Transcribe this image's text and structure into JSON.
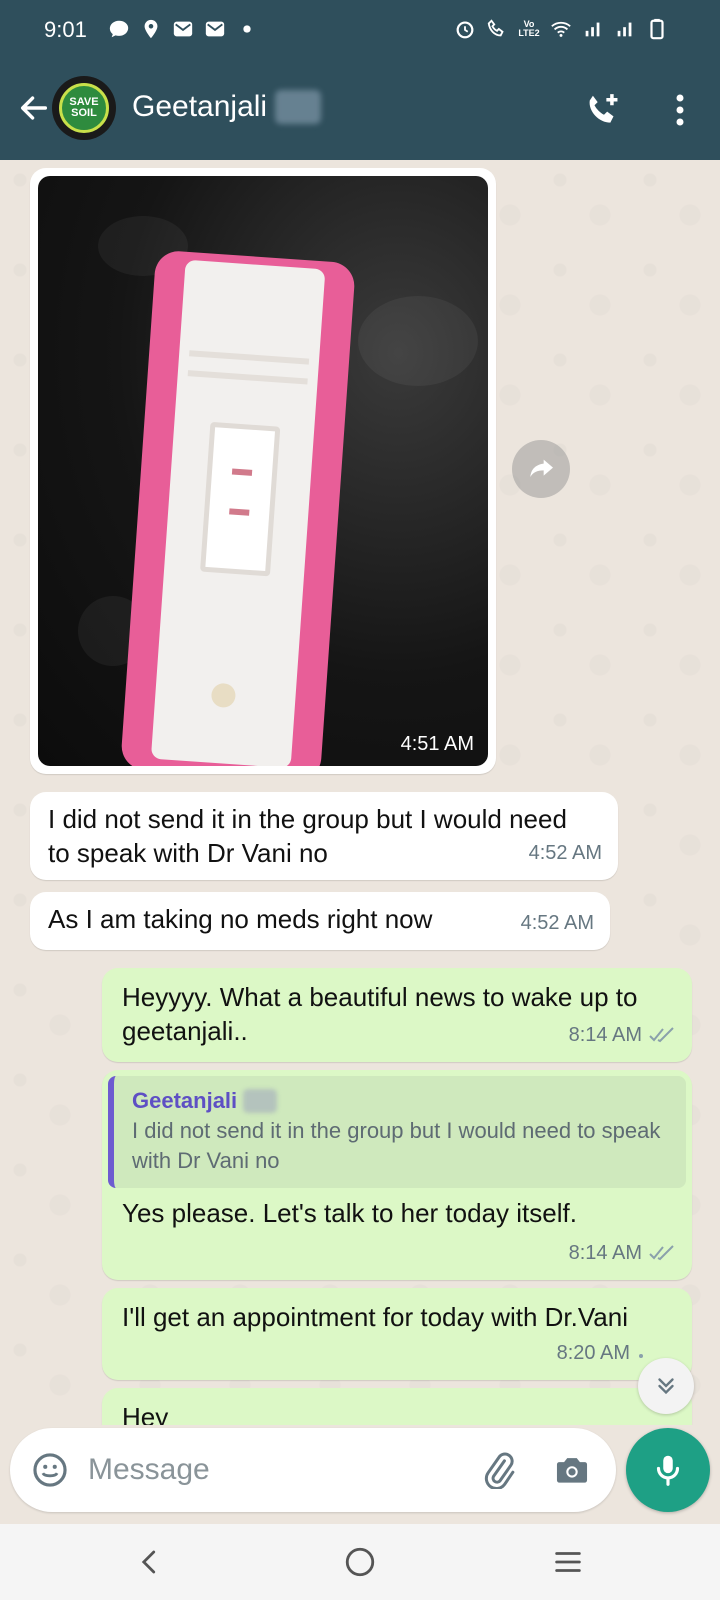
{
  "status_bar": {
    "time": "9:01",
    "left_icons": [
      "chat-bubble-icon",
      "location-icon",
      "mail-icon",
      "mail-icon",
      "dot-icon"
    ],
    "right_icons": [
      "alarm-icon",
      "wifi-call-icon",
      "volte-icon",
      "wifi-icon",
      "signal-icon",
      "signal-icon",
      "battery-icon"
    ],
    "volte_text": "Vo LTE2"
  },
  "header": {
    "contact_name": "Geetanjali",
    "avatar_text_1": "SAVE",
    "avatar_text_2": "SOIL",
    "icons": [
      "back-arrow-icon",
      "add-call-icon",
      "more-vert-icon"
    ]
  },
  "messages": [
    {
      "type": "image",
      "direction": "incoming",
      "time": "4:51 AM"
    },
    {
      "type": "text",
      "direction": "incoming",
      "text": "I did not send it in the group but I would need to speak with Dr Vani no",
      "time": "4:52 AM"
    },
    {
      "type": "text",
      "direction": "incoming",
      "text": "As I am taking no meds right now",
      "time": "4:52 AM"
    },
    {
      "type": "text",
      "direction": "outgoing",
      "text": "Heyyyy. What a beautiful news to wake up to geetanjali..",
      "time": "8:14 AM",
      "status": "read"
    },
    {
      "type": "reply",
      "direction": "outgoing",
      "quote_name": "Geetanjali",
      "quote_text": "I did not send it in the group but I would need to speak with Dr Vani no",
      "text": "Yes please. Let's talk to her today itself.",
      "time": "8:14 AM",
      "status": "read"
    },
    {
      "type": "text",
      "direction": "outgoing",
      "text": "I'll get an appointment for today with Dr.Vani",
      "time": "8:20 AM",
      "status": "pending"
    },
    {
      "type": "text",
      "direction": "outgoing",
      "text": "Hey",
      "time": ""
    }
  ],
  "composer": {
    "placeholder": "Message",
    "icons": [
      "emoji-icon",
      "attach-icon",
      "camera-icon",
      "mic-icon"
    ]
  },
  "navbar": {
    "icons": [
      "nav-back-icon",
      "nav-home-icon",
      "nav-recents-icon"
    ]
  },
  "colors": {
    "header_bg": "#2f4f5c",
    "chat_bg": "#ece5dd",
    "outgoing_bubble": "#dcf8c6",
    "incoming_bubble": "#ffffff",
    "accent_green": "#1ea085",
    "quote_bar": "#6d5bd0",
    "read_ticks": "#8aa0ab"
  }
}
